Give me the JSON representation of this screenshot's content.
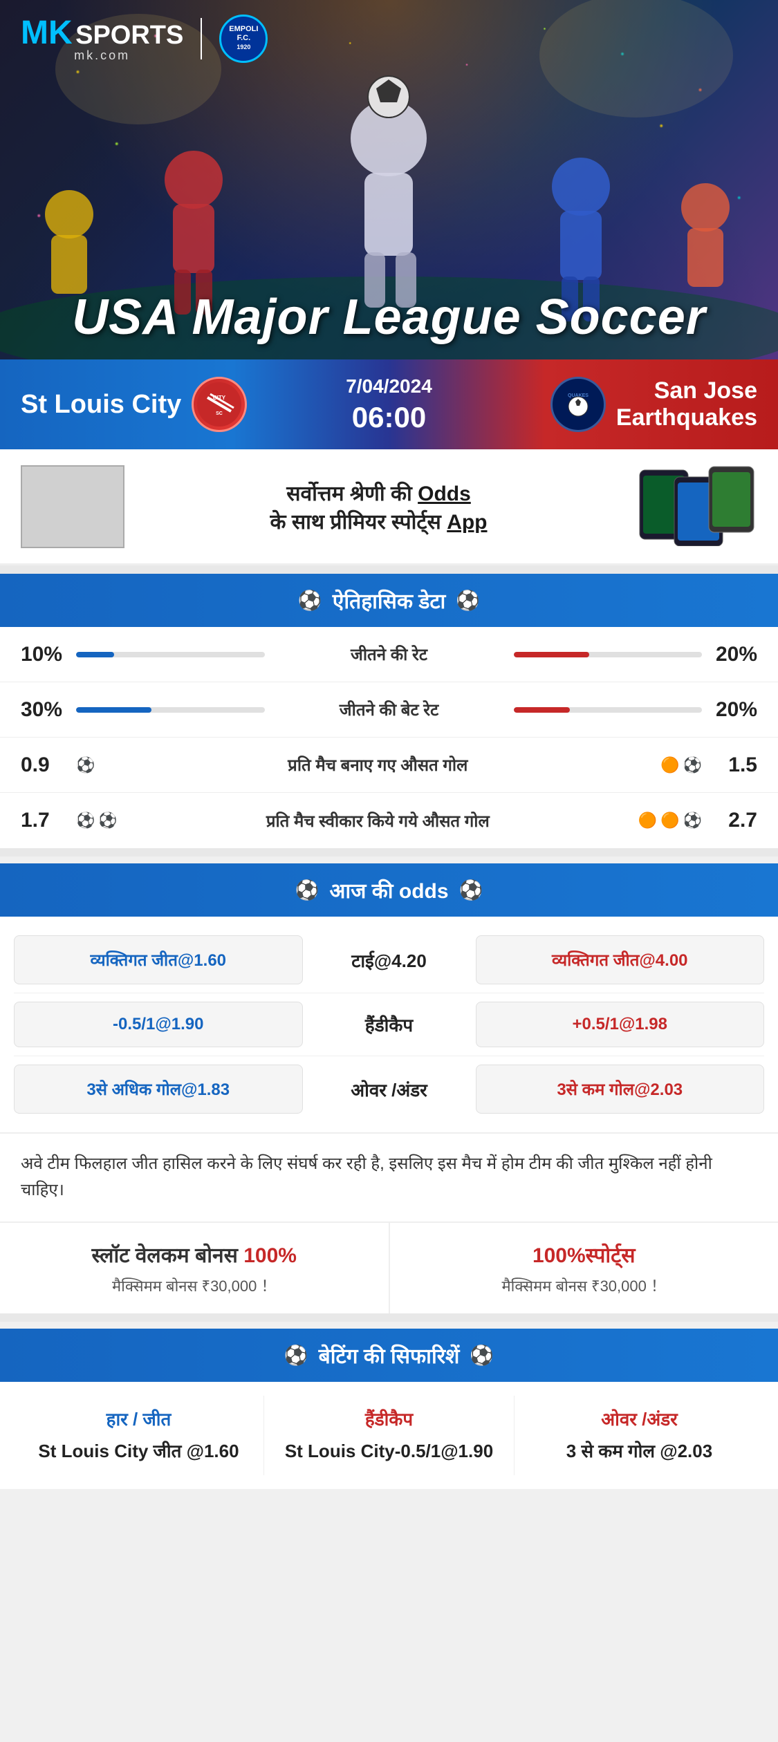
{
  "brand": {
    "mk_logo": "MK",
    "sports_label": "SPORTS",
    "mk_com": "mk.com",
    "empoli_label": "EMPOLI F.C.\n1920"
  },
  "hero": {
    "title": "USA Major League Soccer"
  },
  "match": {
    "team_left": "St Louis City",
    "team_right": "San Jose\nEarthquakes",
    "team_right_single": "San Jose Earthquakes",
    "date": "7/04/2024",
    "time": "06:00",
    "quakes_abbr": "QUAKES"
  },
  "promo": {
    "text_line1": "सर्वोत्तम श्रेणी की",
    "text_odds": "Odds",
    "text_line2": "के साथ प्रीमियर स्पोर्ट्स",
    "text_app": "App"
  },
  "historical_section": {
    "header": "ऐतिहासिक डेटा",
    "rows": [
      {
        "label": "जीतने की रेट",
        "left_val": "10%",
        "right_val": "20%",
        "left_pct": 20,
        "right_pct": 40
      },
      {
        "label": "जीतने की बेट रेट",
        "left_val": "30%",
        "right_val": "20%",
        "left_pct": 40,
        "right_pct": 30
      },
      {
        "label": "प्रति मैच बनाए गए औसत गोल",
        "left_val": "0.9",
        "right_val": "1.5",
        "left_balls": 1,
        "right_balls": 2
      },
      {
        "label": "प्रति मैच स्वीकार किये गये औसत गोल",
        "left_val": "1.7",
        "right_val": "2.7",
        "left_balls": 2,
        "right_balls": 3
      }
    ]
  },
  "odds_section": {
    "header": "आज की odds",
    "rows": [
      {
        "left": "व्यक्तिगत जीत@1.60",
        "center": "टाई@4.20",
        "right": "व्यक्तिगत जीत@4.00"
      },
      {
        "left": "-0.5/1@1.90",
        "center": "हैंडीकैप",
        "right": "+0.5/1@1.98"
      },
      {
        "left": "3से अधिक गोल@1.83",
        "center": "ओवर /अंडर",
        "right": "3से कम गोल@2.03"
      }
    ]
  },
  "analysis": {
    "text": "अवे टीम फिलहाल जीत हासिल करने के लिए संघर्ष कर रही है, इसलिए इस मैच में होम टीम की जीत मुश्किल नहीं होनी चाहिए।"
  },
  "bonus": {
    "slot_title": "स्लॉट वेलकम बोनस",
    "slot_percent": "100%",
    "slot_sub": "मैक्सिमम बोनस ₹30,000  ！",
    "sports_title": "100%स्पोर्ट्स",
    "sports_sub": "मैक्सिमम बोनस  ₹30,000 ！"
  },
  "betting_recs": {
    "header": "बेटिंग की सिफारिशें",
    "cols": [
      {
        "type": "हार / जीत",
        "value": "St Louis City जीत @1.60"
      },
      {
        "type": "हैंडीकैप",
        "value": "St Louis City-0.5/1@1.90"
      },
      {
        "type": "ओवर /अंडर",
        "value": "3 से कम गोल @2.03"
      }
    ]
  },
  "colors": {
    "blue": "#1565C0",
    "red": "#C62828",
    "accent_blue": "#00BFFF"
  }
}
